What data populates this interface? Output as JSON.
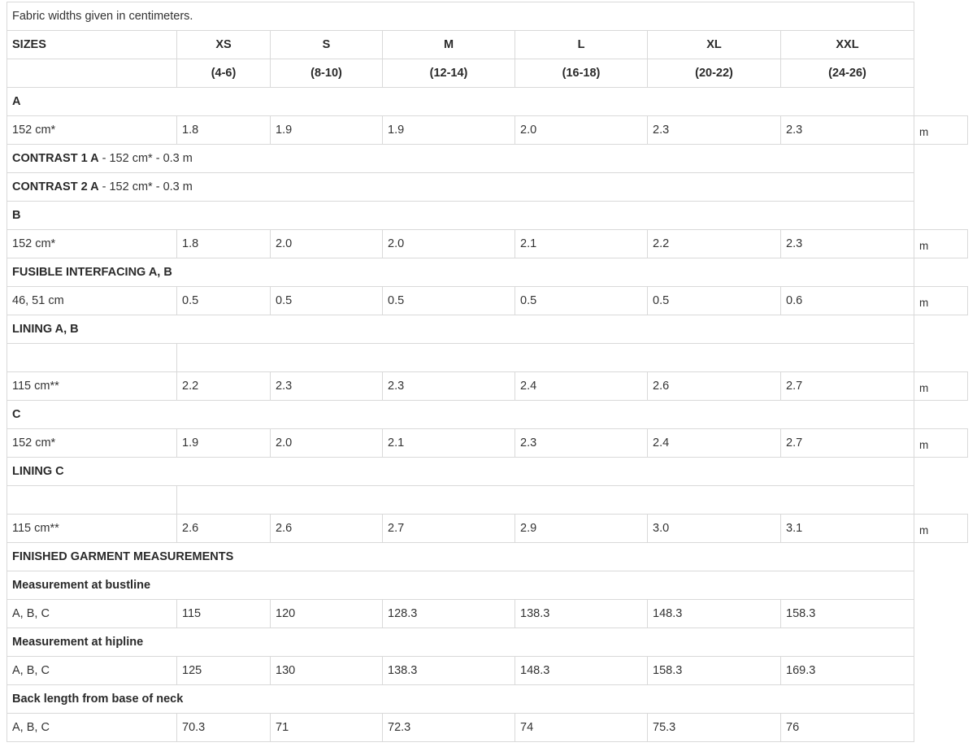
{
  "note": "Fabric widths given in centimeters.",
  "header": {
    "label": "SIZES",
    "sizes": [
      "XS",
      "S",
      "M",
      "L",
      "XL",
      "XXL"
    ],
    "ranges": [
      "(4-6)",
      "(8-10)",
      "(12-14)",
      "(16-18)",
      "(20-22)",
      "(24-26)"
    ]
  },
  "unit": "m",
  "rows": [
    {
      "type": "section",
      "label": "A"
    },
    {
      "type": "data",
      "label": "152 cm*",
      "values": [
        "1.8",
        "1.9",
        "1.9",
        "2.0",
        "2.3",
        "2.3"
      ],
      "unit": true
    },
    {
      "type": "section",
      "label": "CONTRAST 1 A",
      "suffix": " - 152 cm* - 0.3 m"
    },
    {
      "type": "section",
      "label": "CONTRAST 2 A",
      "suffix": " - 152 cm* - 0.3 m"
    },
    {
      "type": "section",
      "label": "B"
    },
    {
      "type": "data",
      "label": "152 cm*",
      "values": [
        "1.8",
        "2.0",
        "2.0",
        "2.1",
        "2.2",
        "2.3"
      ],
      "unit": true
    },
    {
      "type": "section",
      "label": "FUSIBLE INTERFACING A, B"
    },
    {
      "type": "data",
      "label": "46, 51 cm",
      "values": [
        "0.5",
        "0.5",
        "0.5",
        "0.5",
        "0.5",
        "0.6"
      ],
      "unit": true
    },
    {
      "type": "section",
      "label": "LINING A, B"
    },
    {
      "type": "blank"
    },
    {
      "type": "data",
      "label": "115 cm**",
      "values": [
        "2.2",
        "2.3",
        "2.3",
        "2.4",
        "2.6",
        "2.7"
      ],
      "unit": true
    },
    {
      "type": "section",
      "label": "C"
    },
    {
      "type": "data",
      "label": "152 cm*",
      "values": [
        "1.9",
        "2.0",
        "2.1",
        "2.3",
        "2.4",
        "2.7"
      ],
      "unit": true
    },
    {
      "type": "section",
      "label": "LINING C"
    },
    {
      "type": "blank"
    },
    {
      "type": "data",
      "label": "115 cm**",
      "values": [
        "2.6",
        "2.6",
        "2.7",
        "2.9",
        "3.0",
        "3.1"
      ],
      "unit": true
    },
    {
      "type": "section",
      "label": "FINISHED GARMENT MEASUREMENTS"
    },
    {
      "type": "subsection",
      "label": "Measurement at bustline"
    },
    {
      "type": "data",
      "label": "A, B, C",
      "values": [
        "115",
        "120",
        "128.3",
        "138.3",
        "148.3",
        "158.3"
      ],
      "unit": false
    },
    {
      "type": "subsection",
      "label": "Measurement at hipline"
    },
    {
      "type": "data",
      "label": "A, B, C",
      "values": [
        "125",
        "130",
        "138.3",
        "148.3",
        "158.3",
        "169.3"
      ],
      "unit": false
    },
    {
      "type": "subsection",
      "label": "Back length from base of neck"
    },
    {
      "type": "data",
      "label": "A, B, C",
      "values": [
        "70.3",
        "71",
        "72.3",
        "74",
        "75.3",
        "76"
      ],
      "unit": false
    }
  ]
}
